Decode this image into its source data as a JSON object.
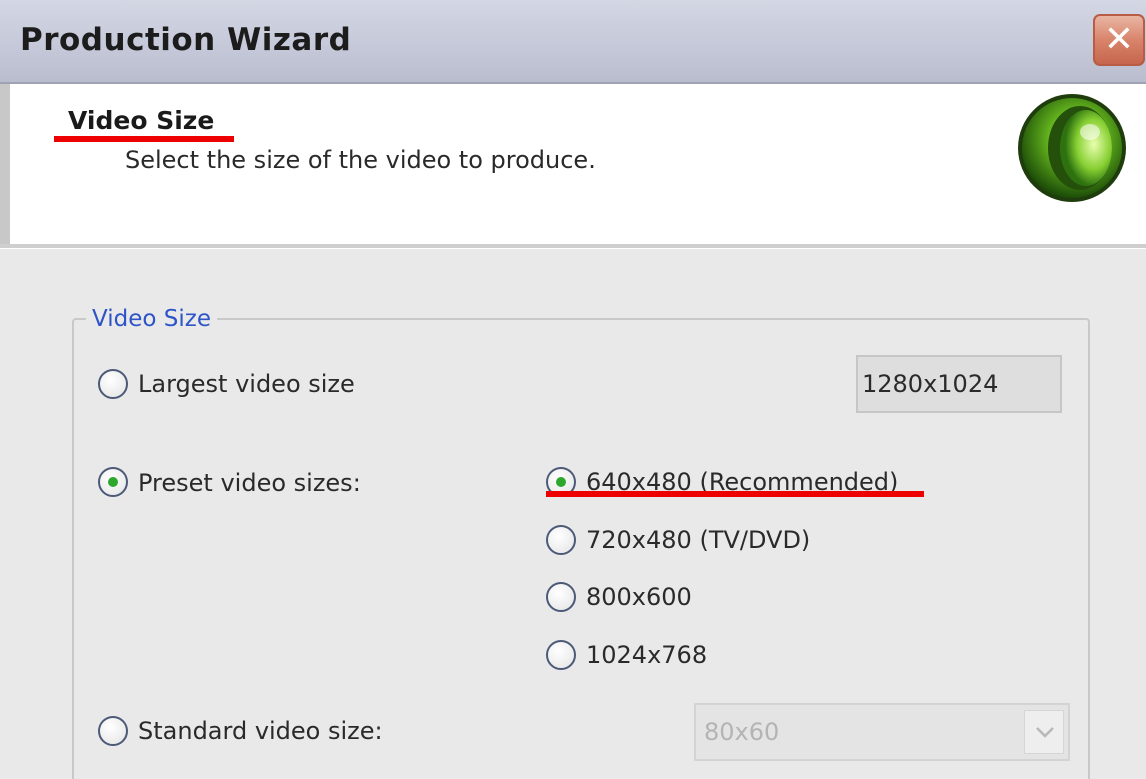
{
  "window": {
    "title": "Production Wizard"
  },
  "header": {
    "title": "Video Size",
    "subtitle": "Select the size of the video to produce."
  },
  "group": {
    "legend": "Video Size",
    "largest": {
      "label": "Largest video size",
      "value": "1280x1024",
      "checked": false
    },
    "preset": {
      "label": "Preset video sizes:",
      "checked": true,
      "options": [
        {
          "label": "640x480 (Recommended)",
          "checked": true
        },
        {
          "label": "720x480 (TV/DVD)",
          "checked": false
        },
        {
          "label": "800x600",
          "checked": false
        },
        {
          "label": "1024x768",
          "checked": false
        }
      ]
    },
    "standard": {
      "label": "Standard video size:",
      "checked": false,
      "select_value": "80x60"
    }
  },
  "icons": {
    "close": "close-icon",
    "logo": "green-orb-logo-icon",
    "dropdown": "chevron-down-icon"
  },
  "colors": {
    "accent_green": "#2da82d",
    "legend_blue": "#2e55c8",
    "annotation_red": "#ee0000"
  }
}
